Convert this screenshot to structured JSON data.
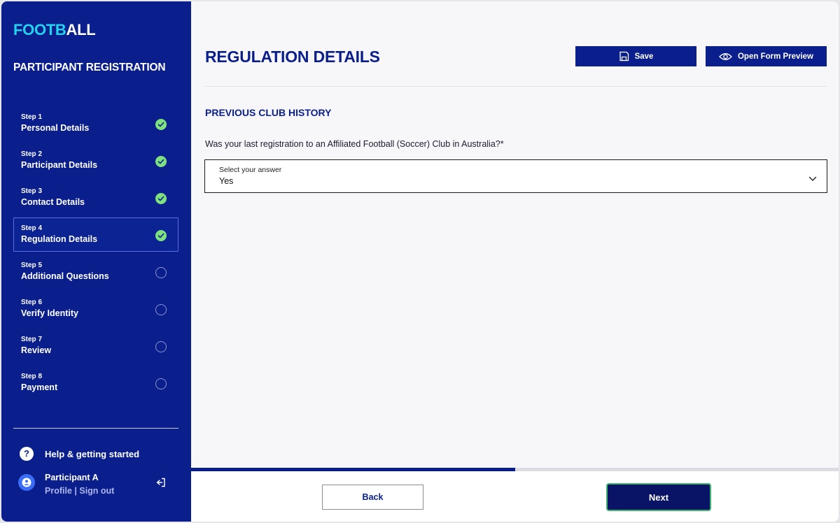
{
  "colors": {
    "brand_navy": "#0a1f8c",
    "accent_cyan": "#22d3ee",
    "check_green": "#7ee07e",
    "next_border": "#3bb36a"
  },
  "sidebar": {
    "logo_part1": "FOOTB",
    "logo_part2": "ALL",
    "title": "PARTICIPANT REGISTRATION",
    "steps": [
      {
        "number": "Step 1",
        "name": "Personal Details",
        "status": "complete"
      },
      {
        "number": "Step 2",
        "name": "Participant Details",
        "status": "complete"
      },
      {
        "number": "Step 3",
        "name": "Contact Details",
        "status": "complete"
      },
      {
        "number": "Step 4",
        "name": "Regulation Details",
        "status": "complete"
      },
      {
        "number": "Step 5",
        "name": "Additional Questions",
        "status": "incomplete"
      },
      {
        "number": "Step 6",
        "name": "Verify Identity",
        "status": "incomplete"
      },
      {
        "number": "Step 7",
        "name": "Review",
        "status": "incomplete"
      },
      {
        "number": "Step 8",
        "name": "Payment",
        "status": "incomplete"
      }
    ],
    "help_label": "Help & getting started",
    "user": {
      "name": "Participant A",
      "profile_link": "Profile",
      "separator": " | ",
      "signout_link": "Sign out"
    }
  },
  "header": {
    "title": "REGULATION DETAILS",
    "save_label": "Save",
    "preview_label": "Open Form Preview"
  },
  "section": {
    "title": "PREVIOUS CLUB HISTORY",
    "question": "Was your last registration to an Affiliated Football (Soccer) Club in Australia?*",
    "select": {
      "label": "Select your answer",
      "value": "Yes"
    }
  },
  "progress": {
    "fraction": 0.5
  },
  "footer": {
    "back_label": "Back",
    "next_label": "Next"
  }
}
